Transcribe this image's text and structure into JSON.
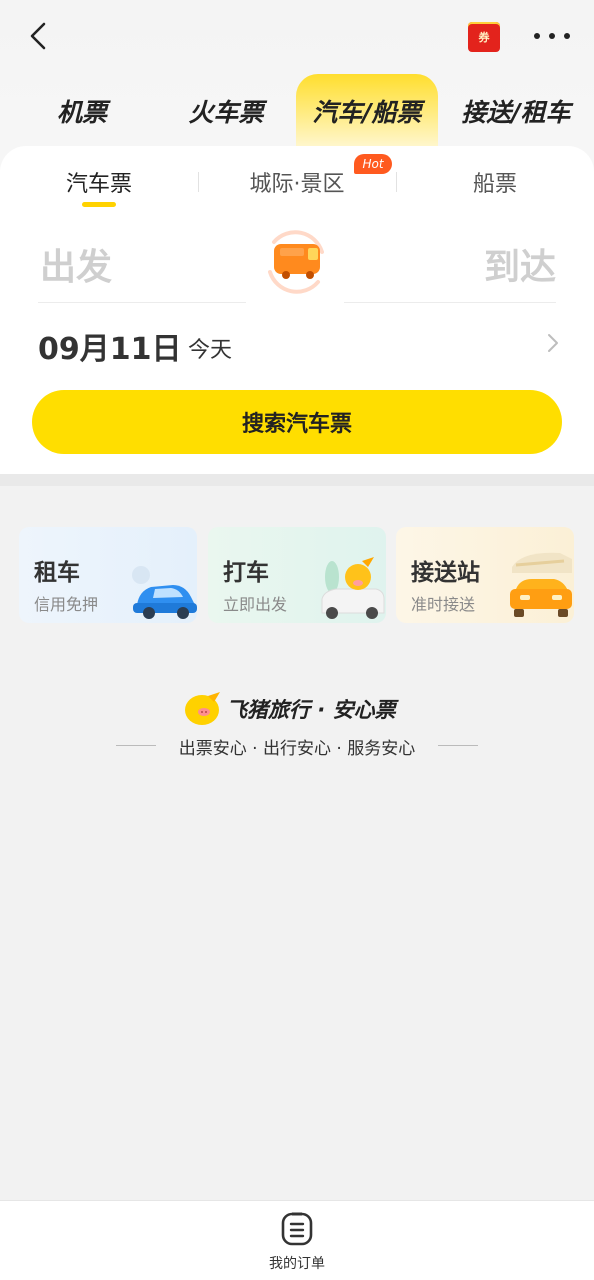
{
  "header": {
    "back_icon": "chevron-left-icon",
    "coupon_label": "券",
    "more_icon": "more-dots-icon"
  },
  "main_tabs": [
    {
      "label": "机票"
    },
    {
      "label": "火车票"
    },
    {
      "label": "汽车/船票",
      "active": true
    },
    {
      "label": "接送/租车"
    }
  ],
  "sub_tabs": [
    {
      "label": "汽车票",
      "active": true
    },
    {
      "label": "城际·景区",
      "badge": "Hot"
    },
    {
      "label": "船票"
    }
  ],
  "route": {
    "from_placeholder": "出发",
    "to_placeholder": "到达",
    "swap_icon": "bus-swap-icon"
  },
  "date": {
    "value": "09月11日",
    "tag": "今天"
  },
  "search_button": "搜索汽车票",
  "services": [
    {
      "title": "租车",
      "subtitle": "信用免押",
      "icon": "blue-car-icon"
    },
    {
      "title": "打车",
      "subtitle": "立即出发",
      "icon": "taxi-mascot-icon"
    },
    {
      "title": "接送站",
      "subtitle": "准时接送",
      "icon": "train-car-icon"
    }
  ],
  "guarantee": {
    "title": "飞猪旅行 · 安心票",
    "subtitle": "出票安心 · 出行安心 · 服务安心"
  },
  "bottom_bar": {
    "orders_label": "我的订单"
  },
  "colors": {
    "accent_yellow": "#ffde00",
    "hot_orange": "#ff5a1f"
  }
}
